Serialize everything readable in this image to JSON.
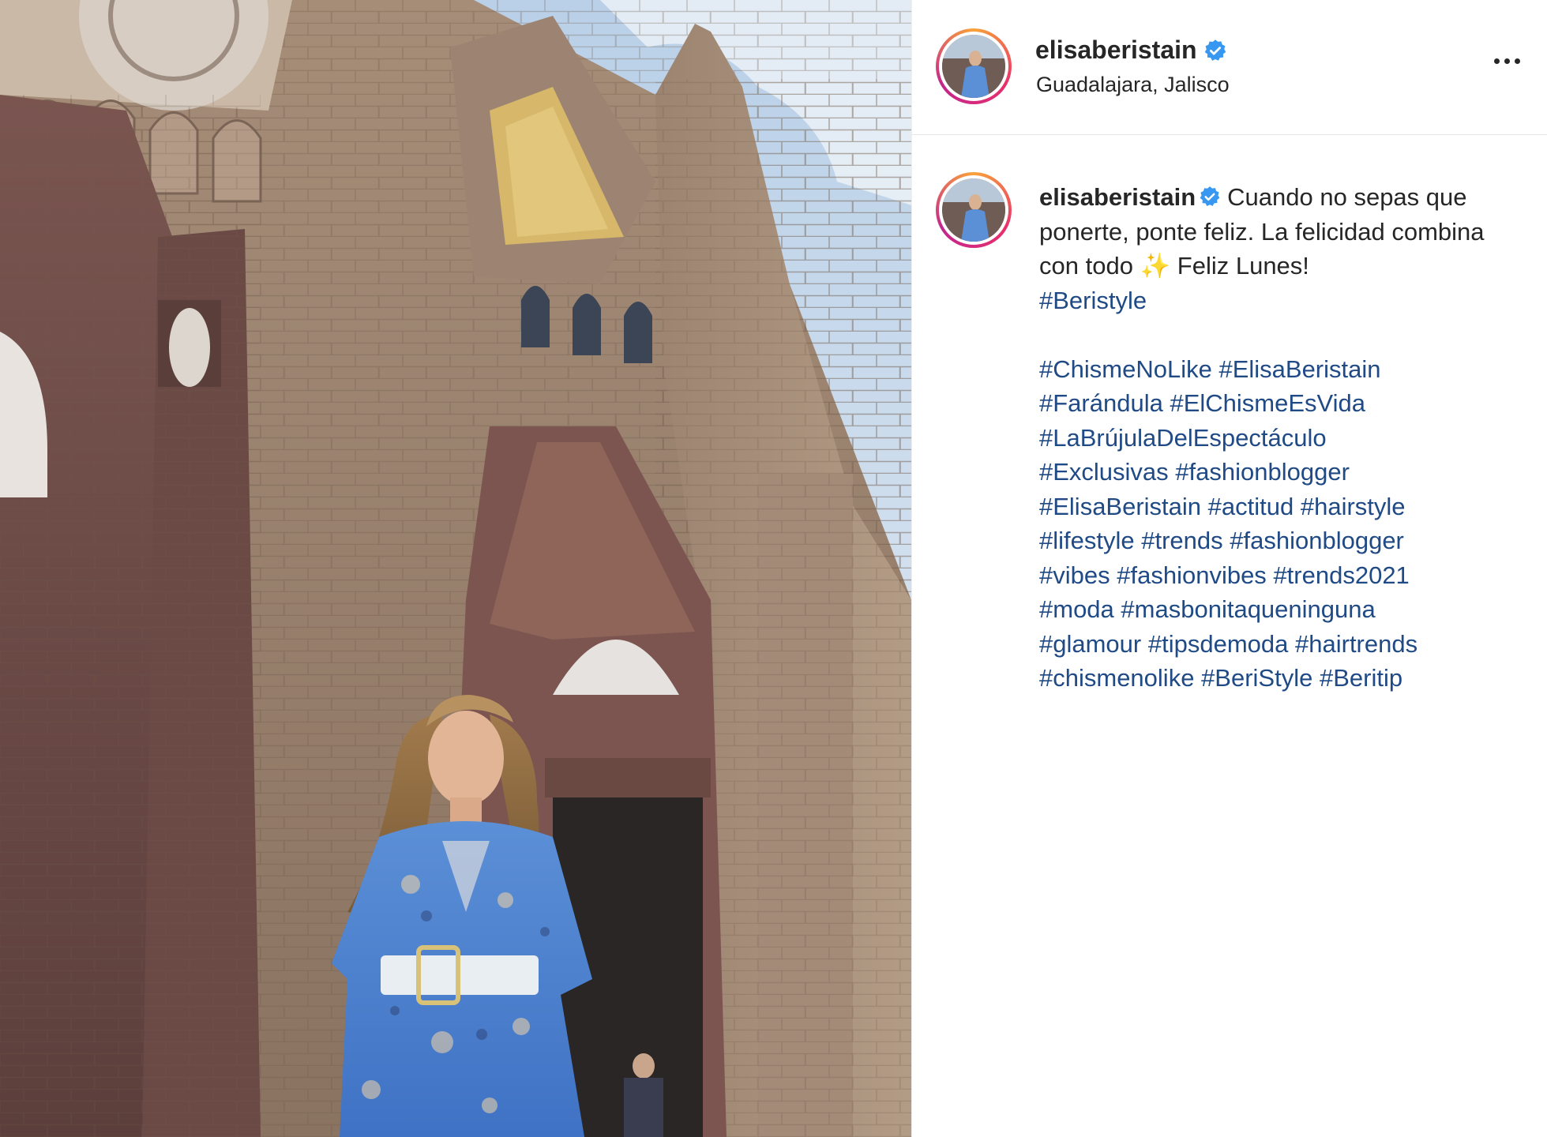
{
  "post": {
    "username": "elisaberistain",
    "verified": true,
    "location": "Guadalajara, Jalisco",
    "photo_alt": "Woman in blue printed dress in front of gothic cathedral"
  },
  "caption": {
    "username": "elisaberistain",
    "text_line1": "Cuando no sepas que ponerte, ponte feliz. La felicidad combina con todo ",
    "sparkle": "✨",
    "text_line2": " Feliz Lunes!",
    "first_hashtag": "#Beristyle",
    "hashtag_lines": [
      [
        "#ChismeNoLike",
        "#ElisaBeristain"
      ],
      [
        "#Farándula",
        "#ElChismeEsVida"
      ],
      [
        "#LaBrújulaDelEspectáculo"
      ],
      [
        "#Exclusivas",
        "#fashionblogger"
      ],
      [
        "#ElisaBeristain",
        "#actitud",
        "#hairstyle"
      ],
      [
        "#lifestyle",
        "#trends",
        "#fashionblogger"
      ],
      [
        "#vibes",
        "#fashionvibes",
        "#trends2021"
      ],
      [
        "#moda",
        "#masbonitaqueninguna"
      ],
      [
        "#glamour",
        "#tipsdemoda",
        "#hairtrends"
      ],
      [
        "#chismenolike",
        "#BeriStyle",
        "#Beritip"
      ]
    ]
  },
  "colors": {
    "username": "#262626",
    "hashtag": "#1f4a85",
    "verified": "#3897f0",
    "divider": "#e6e6e6"
  },
  "icons": {
    "verified": "verified-badge-icon",
    "more": "more-options-icon"
  }
}
